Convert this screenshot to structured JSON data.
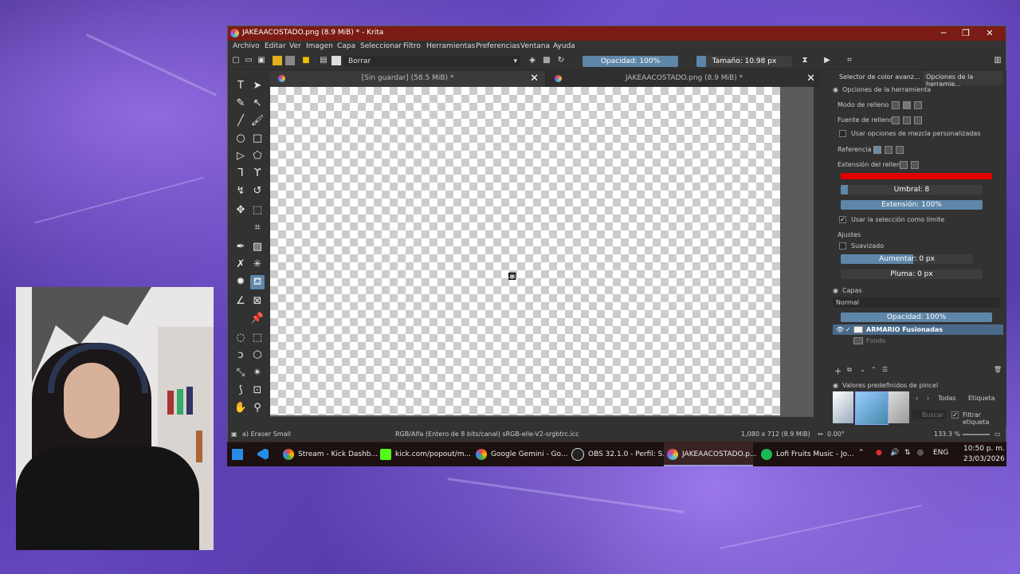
{
  "window": {
    "title": "JAKEAACOSTADO.png (8.9 MiB) * - Krita",
    "controls": {
      "minimize": "─",
      "maximize": "❐",
      "close": "✕"
    }
  },
  "menubar": [
    "Archivo",
    "Editar",
    "Ver",
    "Imagen",
    "Capa",
    "Seleccionar",
    "Filtro",
    "Herramientas",
    "Preferencias",
    "Ventana",
    "Ayuda"
  ],
  "toolbar": {
    "brush_preset": "Borrar",
    "opacity": {
      "label": "Opacidad: 100%",
      "value": 1.0
    },
    "size": {
      "label": "Tamaño: 10.98 px",
      "value": 0.1
    }
  },
  "tabs": [
    {
      "label": "[Sin guardar]  (58.5 MiB) *"
    },
    {
      "label": "JAKEAACOSTADO.png (8.9 MiB) *"
    }
  ],
  "statusbar": {
    "brush": "a) Eraser Small",
    "colorspace": "RGB/Alfa (Entero de 8 bits/canal)  sRGB-elle-V2-srgbtrc.icc",
    "dimensions": "1,080 x 712 (8.9 MiB)",
    "rotation": "0.00°",
    "zoom": "133.3 %"
  },
  "dock": {
    "tabs": [
      "Selector de color avanz...",
      "Opciones de la herramie..."
    ],
    "tool_options_title": "Opciones de la herramienta",
    "fill_mode": "Modo de relleno",
    "fill_source": "Fuente de relleno",
    "custom_blend": "Usar opciones de mezcla personalizadas",
    "reference": "Referencia",
    "fill_extent": "Extensión del relleno",
    "fill_color": "#e00000",
    "threshold": {
      "label": "Umbral: 8",
      "value": 0.05
    },
    "extension": {
      "label": "Extensión: 100%",
      "value": 1.0
    },
    "use_selection": "Usar la selección como límite",
    "adjustments": "Ajustes",
    "antialias": "Suavizado",
    "grow": {
      "label": "Aumentar: 0 px",
      "value": 0.55
    },
    "feather": {
      "label": "Pluma: 0 px",
      "value": 0.0
    },
    "layers_title": "Capas",
    "blend_mode": "Normal",
    "layer_opacity": {
      "label": "Opacidad:  100%",
      "value": 1.0
    },
    "layers": [
      {
        "name": "ARMARIO Fusionadas",
        "selected": true
      },
      {
        "name": "Fondo",
        "selected": false
      }
    ],
    "brush_presets_title": "Valores predefinidos de pincel",
    "tag_filter": "Todas",
    "tag_label": "Etiqueta",
    "search_placeholder": "Buscar",
    "filter_by_tag": "Filtrar etiqueta"
  },
  "taskbar": {
    "items": [
      {
        "label": "Stream - Kick Dashb...",
        "color": "#4285f4"
      },
      {
        "label": "kick.com/popout/m...",
        "color": "#53fc18"
      },
      {
        "label": "Google Gemini - Go...",
        "color": "#4285f4"
      },
      {
        "label": "OBS 32.1.0 - Perfil: S...",
        "color": "#222222"
      },
      {
        "label": "JAKEAACOSTADO.p...",
        "color": "#c050e0"
      },
      {
        "label": "Lofi Fruits Music - Jo...",
        "color": "#1db954"
      }
    ],
    "language": "ENG",
    "time": "10:50 p. m.",
    "date": "23/03/2026"
  }
}
